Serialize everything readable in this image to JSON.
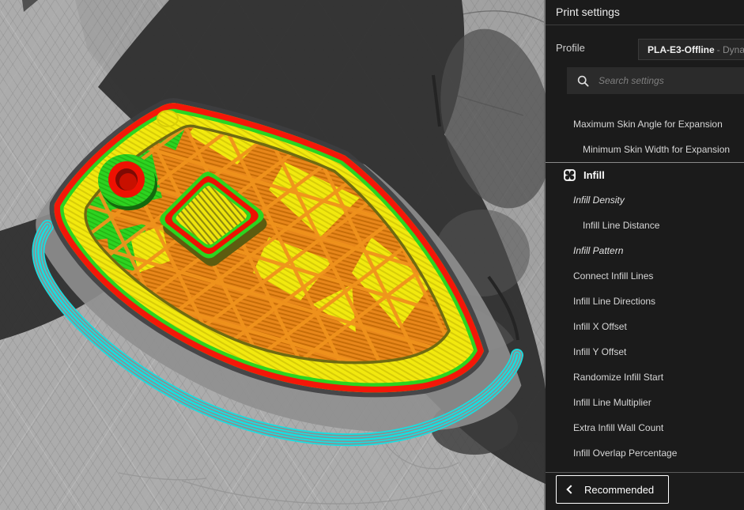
{
  "panel": {
    "title": "Print settings",
    "profile": {
      "label": "Profile",
      "value": "PLA-E3-Offline",
      "value_suffix": "- Dynam"
    },
    "search": {
      "placeholder": "Search settings"
    },
    "settings": [
      {
        "label": "Maximum Skin Angle for Expansion",
        "indent": 1,
        "italic": false
      },
      {
        "label": "Minimum Skin Width for Expansion",
        "indent": 2,
        "italic": false
      },
      {
        "label": "Infill",
        "category": true
      },
      {
        "label": "Infill Density",
        "indent": 1,
        "italic": true
      },
      {
        "label": "Infill Line Distance",
        "indent": 2,
        "italic": false
      },
      {
        "label": "Infill Pattern",
        "indent": 1,
        "italic": true
      },
      {
        "label": "Connect Infill Lines",
        "indent": 1,
        "italic": false
      },
      {
        "label": "Infill Line Directions",
        "indent": 1,
        "italic": false
      },
      {
        "label": "Infill X Offset",
        "indent": 1,
        "italic": false
      },
      {
        "label": "Infill Y Offset",
        "indent": 1,
        "italic": false
      },
      {
        "label": "Randomize Infill Start",
        "indent": 1,
        "italic": false
      },
      {
        "label": "Infill Line Multiplier",
        "indent": 1,
        "italic": false
      },
      {
        "label": "Extra Infill Wall Count",
        "indent": 1,
        "italic": false
      },
      {
        "label": "Infill Overlap Percentage",
        "indent": 1,
        "italic": false
      }
    ],
    "footer": {
      "recommended_label": "Recommended"
    }
  },
  "viewport": {
    "colors": {
      "outer_wall": "#f41708",
      "inner_wall": "#2bd51f",
      "top_skin": "#f2e90e",
      "infill": "#e8871b",
      "infill_lines": "#f0931d",
      "skirt_brim": "#17dfe2",
      "ghost_model": "#2f2f2f",
      "build_plate": "#acacac"
    }
  }
}
